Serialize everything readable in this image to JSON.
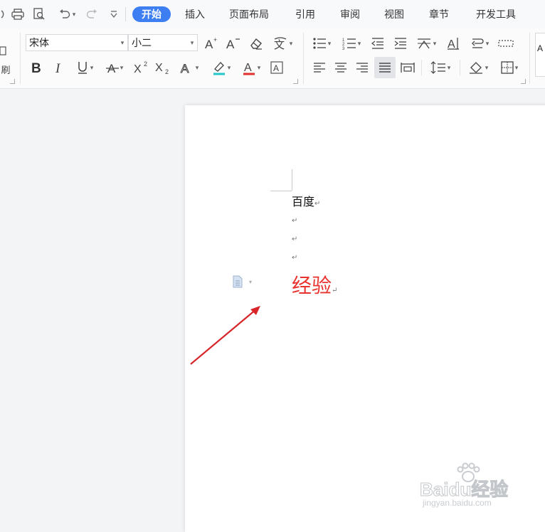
{
  "tabs": [
    {
      "label": "开始",
      "active": true
    },
    {
      "label": "插入"
    },
    {
      "label": "页面布局"
    },
    {
      "label": "引用"
    },
    {
      "label": "审阅"
    },
    {
      "label": "视图"
    },
    {
      "label": "章节"
    },
    {
      "label": "开发工具"
    }
  ],
  "ribbon": {
    "font_name": "宋体",
    "font_size": "小二",
    "format_painter_label": "刷",
    "style_preview": "A"
  },
  "document": {
    "line1": "百度",
    "paragraph_mark": "↵",
    "line5": "经验",
    "line5_color": "#e8332f"
  },
  "watermark": {
    "brand": "Baidu经验",
    "url": "jingyan.baidu.com"
  },
  "colors": {
    "accent": "#3d7ef2",
    "highlight": "#22c7c7",
    "font_color_bar": "#e0302a",
    "arrow": "#d8252a"
  }
}
